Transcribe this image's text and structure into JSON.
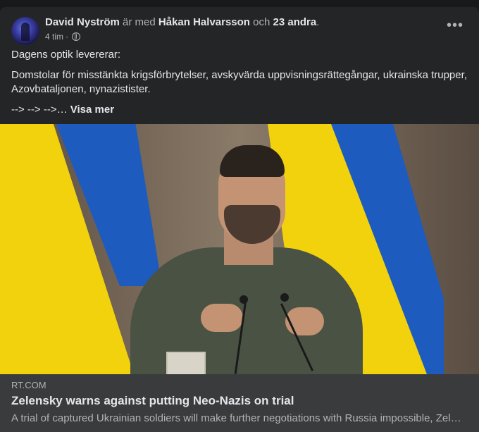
{
  "post": {
    "author": "David Nyström",
    "with_word": "är med",
    "tagged": "Håkan Halvarsson",
    "and_word": "och",
    "others": "23 andra",
    "period": ".",
    "time": "4 tim",
    "dot": "·",
    "audience_icon": "globe-icon",
    "more_icon": "•••",
    "text_p1": "Dagens optik levererar:",
    "text_p2": "Domstolar för misstänkta krigsförbrytelser, avskyvärda uppvisningsrättegångar, ukrainska trupper, Azovbataljonen, nynazistister.",
    "text_p3": "--> --> -->…",
    "see_more": "Visa mer"
  },
  "link": {
    "domain": "RT.COM",
    "title": "Zelensky warns against putting Neo-Nazis on trial",
    "description": "A trial of captured Ukrainian soldiers will make further negotiations with Russia impossible, Zelensky said"
  },
  "colors": {
    "background": "#18191a",
    "card": "#242526",
    "link_box": "#3a3b3c",
    "text_primary": "#e4e6eb",
    "text_secondary": "#b0b3b8",
    "flag_yellow": "#f2d20c",
    "flag_blue": "#1d5bbf"
  }
}
